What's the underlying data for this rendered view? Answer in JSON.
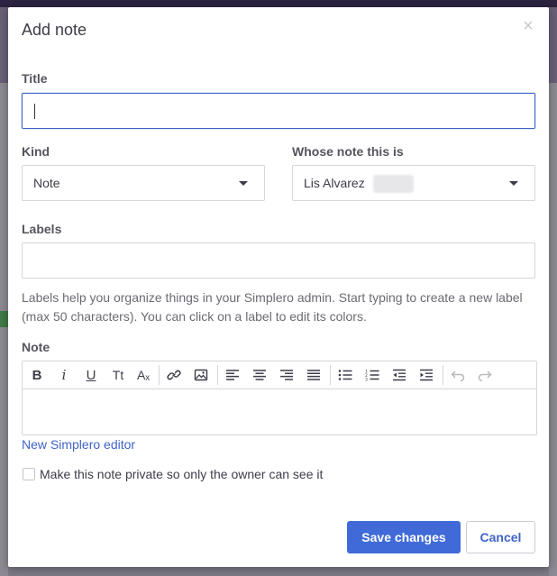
{
  "modal": {
    "title": "Add note",
    "close_glyph": "×"
  },
  "title_field": {
    "label": "Title",
    "value": "",
    "focused": true
  },
  "kind_field": {
    "label": "Kind",
    "selected": "Note"
  },
  "owner_field": {
    "label": "Whose note this is",
    "selected": "Lis Alvarez"
  },
  "labels_field": {
    "label": "Labels",
    "value": "",
    "help": "Labels help you organize things in your Simplero admin. Start typing to create a new label (max 50 characters). You can click on a label to edit its colors."
  },
  "note_field": {
    "label": "Note",
    "toolbar": [
      {
        "icon": "bold-icon",
        "glyph": "B"
      },
      {
        "icon": "italic-icon",
        "glyph": "i"
      },
      {
        "icon": "underline-icon",
        "glyph": "U"
      },
      {
        "icon": "text-size-icon",
        "glyph": "Tt"
      },
      {
        "icon": "clear-formatting-icon",
        "glyph": "Aₓ"
      },
      {
        "icon": "link-icon"
      },
      {
        "icon": "image-icon"
      },
      {
        "icon": "align-left-icon"
      },
      {
        "icon": "align-center-icon"
      },
      {
        "icon": "align-right-icon"
      },
      {
        "icon": "align-justify-icon"
      },
      {
        "icon": "bulleted-list-icon"
      },
      {
        "icon": "numbered-list-icon"
      },
      {
        "icon": "outdent-icon"
      },
      {
        "icon": "indent-icon"
      },
      {
        "icon": "undo-icon",
        "disabled": true
      },
      {
        "icon": "redo-icon",
        "disabled": true
      }
    ],
    "value": ""
  },
  "editor_link": "New Simplero editor",
  "private_checkbox": {
    "label": "Make this note private so only the owner can see it",
    "checked": false
  },
  "actions": {
    "save_label": "Save changes",
    "cancel_label": "Cancel"
  },
  "colors": {
    "primary": "#3f6ad8",
    "link": "#3f63c9",
    "backdrop": "#7d7a86",
    "border": "#d6d6dc"
  }
}
